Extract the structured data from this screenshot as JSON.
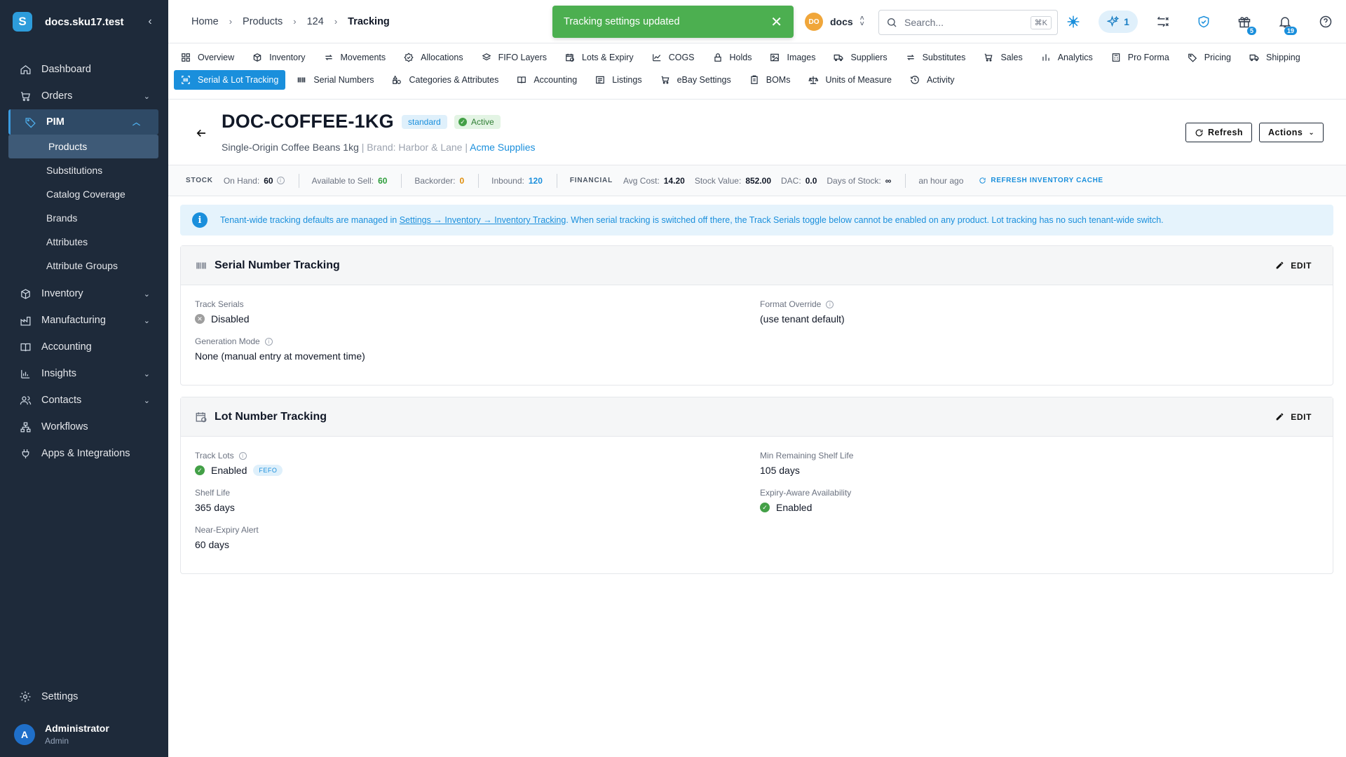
{
  "sidebar": {
    "app_title": "docs.sku17.test",
    "logo_letter": "S",
    "nav": [
      {
        "label": "Dashboard",
        "icon": "home-icon"
      },
      {
        "label": "Orders",
        "icon": "cart-icon"
      },
      {
        "label": "PIM",
        "icon": "tag-icon"
      },
      {
        "label": "Inventory",
        "icon": "box-icon"
      },
      {
        "label": "Manufacturing",
        "icon": "factory-icon"
      },
      {
        "label": "Accounting",
        "icon": "book-icon"
      },
      {
        "label": "Insights",
        "icon": "chart-icon"
      },
      {
        "label": "Contacts",
        "icon": "contacts-icon"
      },
      {
        "label": "Workflows",
        "icon": "workflow-icon"
      },
      {
        "label": "Apps & Integrations",
        "icon": "plug-icon"
      }
    ],
    "pim_sub": [
      "Products",
      "Substitutions",
      "Catalog Coverage",
      "Brands",
      "Attributes",
      "Attribute Groups"
    ],
    "settings_label": "Settings",
    "user": {
      "initial": "A",
      "name": "Administrator",
      "role": "Admin"
    }
  },
  "breadcrumb": [
    "Home",
    "Products",
    "124",
    "Tracking"
  ],
  "toast": {
    "message": "Tracking settings updated"
  },
  "tenant": {
    "initials": "DO",
    "name": "docs"
  },
  "search": {
    "placeholder": "Search...",
    "shortcut": "⌘K"
  },
  "topbar": {
    "ai_count": "1",
    "gift_badge": "5",
    "notif_badge": "19"
  },
  "tabs_row1": [
    "Overview",
    "Inventory",
    "Movements",
    "Allocations",
    "FIFO Layers",
    "Lots & Expiry",
    "COGS",
    "Holds",
    "Images",
    "Suppliers",
    "Substitutes",
    "Sales",
    "Analytics",
    "Pro Forma",
    "Pricing",
    "Shipping"
  ],
  "tabs_row2": [
    "Serial & Lot Tracking",
    "Serial Numbers",
    "Categories & Attributes",
    "Accounting",
    "Listings",
    "eBay Settings",
    "BOMs",
    "Units of Measure",
    "Activity"
  ],
  "product": {
    "sku": "DOC-COFFEE-1KG",
    "type_chip": "standard",
    "status_chip": "Active",
    "name": "Single-Origin Coffee Beans 1kg",
    "brand_text": "| Brand: Harbor & Lane |",
    "supplier": "Acme Supplies",
    "refresh_label": "Refresh",
    "actions_label": "Actions"
  },
  "stock": {
    "group_stock": "STOCK",
    "on_hand_label": "On Hand:",
    "on_hand": "60",
    "ats_label": "Available to Sell:",
    "ats": "60",
    "backorder_label": "Backorder:",
    "backorder": "0",
    "inbound_label": "Inbound:",
    "inbound": "120",
    "group_financial": "FINANCIAL",
    "avg_cost_label": "Avg Cost:",
    "avg_cost": "14.20",
    "stock_value_label": "Stock Value:",
    "stock_value": "852.00",
    "dac_label": "DAC:",
    "dac": "0.0",
    "dos_label": "Days of Stock:",
    "dos": "∞",
    "updated": "an hour ago",
    "refresh_cache": "REFRESH INVENTORY CACHE"
  },
  "alert": {
    "pre": "Tenant-wide tracking defaults are managed in ",
    "link": "Settings → Inventory → Inventory Tracking",
    "post": ". When serial tracking is switched off there, the Track Serials toggle below cannot be enabled on any product. Lot tracking has no such tenant-wide switch."
  },
  "serial": {
    "title": "Serial Number Tracking",
    "edit": "EDIT",
    "track_label": "Track Serials",
    "track_value": "Disabled",
    "format_label": "Format Override",
    "format_value": "(use tenant default)",
    "gen_label": "Generation Mode",
    "gen_value": "None (manual entry at movement time)"
  },
  "lot": {
    "title": "Lot Number Tracking",
    "edit": "EDIT",
    "track_label": "Track Lots",
    "track_value": "Enabled",
    "track_badge": "FEFO",
    "shelf_label": "Shelf Life",
    "shelf_value": "365 days",
    "near_label": "Near-Expiry Alert",
    "near_value": "60 days",
    "min_label": "Min Remaining Shelf Life",
    "min_value": "105 days",
    "expiry_label": "Expiry-Aware Availability",
    "expiry_value": "Enabled"
  }
}
